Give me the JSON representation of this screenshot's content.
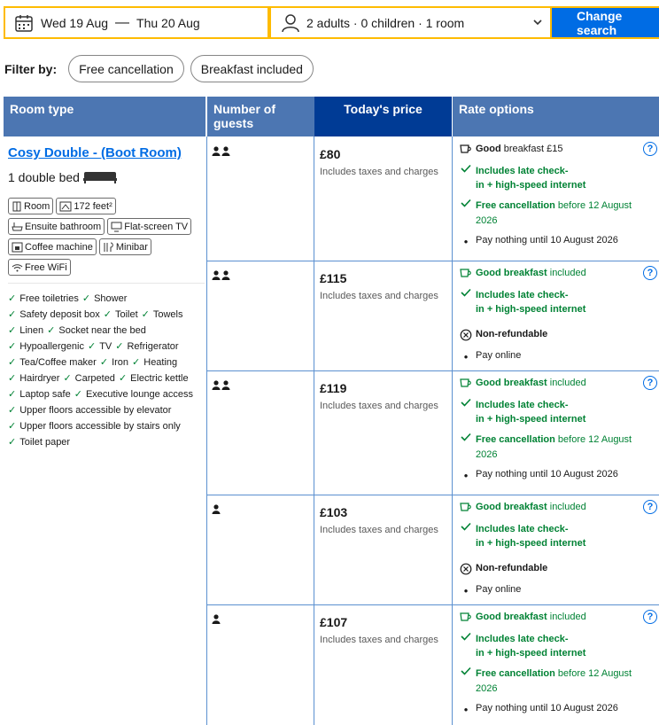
{
  "search": {
    "check_in": "Wed 19 Aug",
    "dash": "—",
    "check_out": "Thu 20 Aug",
    "occupancy": "2 adults · 0 children · 1 room",
    "button": "Change search"
  },
  "filter": {
    "label": "Filter by:",
    "chips": [
      "Free cancellation",
      "Breakfast included"
    ]
  },
  "table": {
    "headers": {
      "room_type": "Room type",
      "guests": "Number of guests",
      "price": "Today's price",
      "rate": "Rate options"
    },
    "room": {
      "name": "Cosy Double - (Boot Room)",
      "bed": "1 double bed",
      "features": [
        "Room",
        "172 feet²",
        "Ensuite bathroom",
        "Flat-screen TV",
        "Coffee machine",
        "Minibar",
        "Free WiFi"
      ],
      "amenities": [
        [
          "Free toiletries",
          "Shower"
        ],
        [
          "Safety deposit box",
          "Toilet",
          "Towels"
        ],
        [
          "Linen",
          "Socket near the bed"
        ],
        [
          "Hypoallergenic",
          "TV",
          "Refrigerator"
        ],
        [
          "Tea/Coffee maker",
          "Iron",
          "Heating"
        ],
        [
          "Hairdryer",
          "Carpeted",
          "Electric kettle"
        ],
        [
          "Laptop safe",
          "Executive lounge access"
        ],
        [
          "Upper floors accessible by elevator"
        ],
        [
          "Upper floors accessible by stairs only"
        ],
        [
          "Toilet paper"
        ]
      ]
    },
    "rows": [
      {
        "guests": 2,
        "price": "£80",
        "tax": "Includes taxes and charges",
        "breakfast_bold": "Good",
        "breakfast_rest": " breakfast £15",
        "late": [
          "Includes late check-",
          "in + high-speed internet"
        ],
        "cancel_bold": "Free cancellation",
        "cancel_rest": " before 12 August",
        "cancel_year": "2026",
        "pay": "Pay nothing until 10 August 2026"
      },
      {
        "guests": 2,
        "price": "£115",
        "tax": "Includes taxes and charges",
        "breakfast_bold": "Good breakfast",
        "breakfast_rest": " included",
        "late": [
          "Includes late check-",
          "in + high-speed internet"
        ],
        "nonref": "Non-refundable",
        "pay": "Pay online"
      },
      {
        "guests": 2,
        "price": "£119",
        "tax": "Includes taxes and charges",
        "breakfast_bold": "Good breakfast",
        "breakfast_rest": " included",
        "late": [
          "Includes late check-",
          "in + high-speed internet"
        ],
        "cancel_bold": "Free cancellation",
        "cancel_rest": " before 12 August",
        "cancel_year": "2026",
        "pay": "Pay nothing until 10 August 2026"
      },
      {
        "guests": 1,
        "price": "£103",
        "tax": "Includes taxes and charges",
        "breakfast_bold": "Good breakfast",
        "breakfast_rest": " included",
        "late": [
          "Includes late check-",
          "in + high-speed internet"
        ],
        "nonref": "Non-refundable",
        "pay": "Pay online"
      },
      {
        "guests": 1,
        "price": "£107",
        "tax": "Includes taxes and charges",
        "breakfast_bold": "Good breakfast",
        "breakfast_rest": " included",
        "late": [
          "Includes late check-",
          "in + high-speed internet"
        ],
        "cancel_bold": "Free cancellation",
        "cancel_rest": " before 12 August",
        "cancel_year": "2026",
        "pay": "Pay nothing until 10 August 2026"
      }
    ]
  },
  "colors": {
    "accent": "#006ce4",
    "header": "#4c76b2",
    "price_header": "#003b95",
    "green": "#008234",
    "search_border": "#febb02"
  }
}
